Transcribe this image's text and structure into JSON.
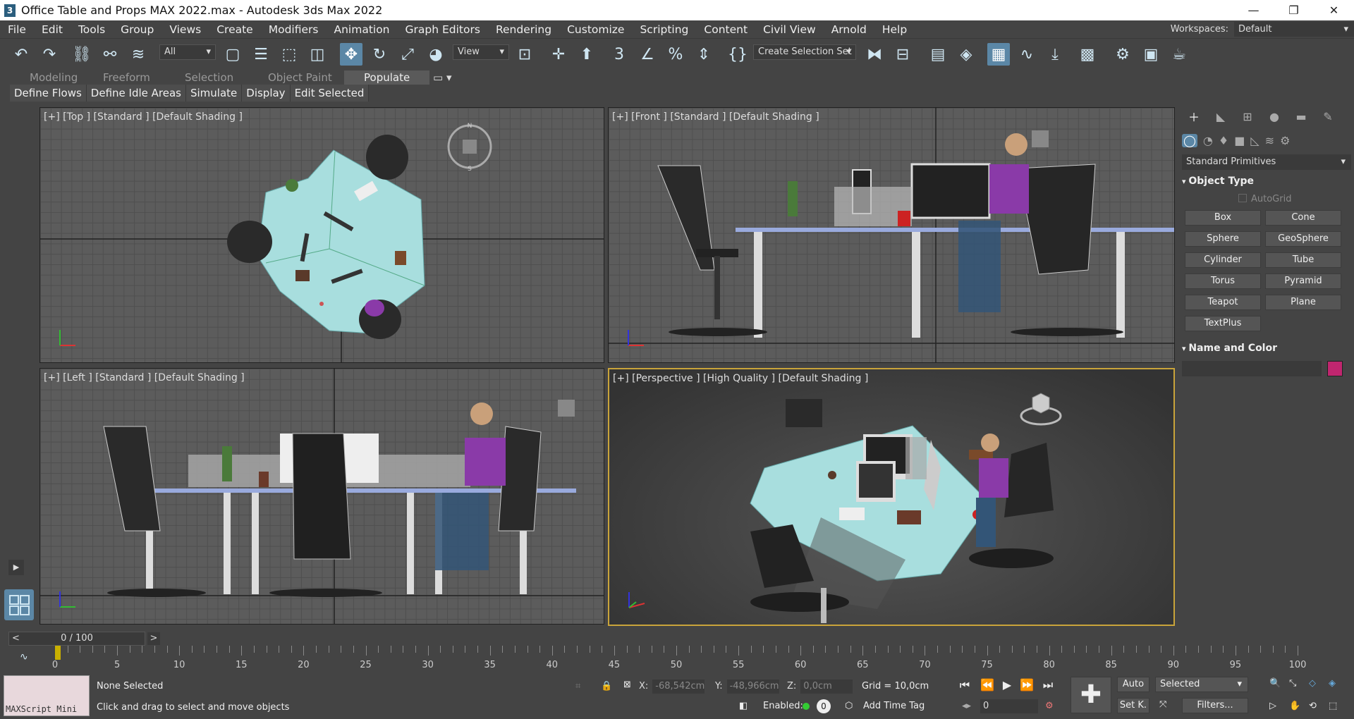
{
  "window": {
    "title": "Office Table and Props MAX 2022.max - Autodesk 3ds Max 2022",
    "app_icon": "3"
  },
  "menu": {
    "items": [
      "File",
      "Edit",
      "Tools",
      "Group",
      "Views",
      "Create",
      "Modifiers",
      "Animation",
      "Graph Editors",
      "Rendering",
      "Customize",
      "Scripting",
      "Content",
      "Civil View",
      "Arnold",
      "Help"
    ],
    "workspaces_label": "Workspaces:",
    "workspace_value": "Default"
  },
  "toolbar": {
    "filter": "All",
    "ref_coord": "View",
    "selection_set": "Create Selection Set"
  },
  "ribbon": {
    "tabs": [
      "Modeling",
      "Freeform",
      "Selection",
      "Object Paint",
      "Populate"
    ],
    "active": "Populate",
    "buttons": [
      "Define Flows",
      "Define Idle Areas",
      "Simulate",
      "Display",
      "Edit Selected"
    ]
  },
  "viewports": {
    "top": "[+] [Top ] [Standard ] [Default Shading ]",
    "front": "[+] [Front ] [Standard ] [Default Shading ]",
    "left": "[+] [Left ] [Standard ] [Default Shading ]",
    "perspective": "[+] [Perspective ] [High Quality ] [Default Shading ]"
  },
  "command_panel": {
    "category": "Standard Primitives",
    "object_type_title": "Object Type",
    "autogrid": "AutoGrid",
    "buttons": [
      "Box",
      "Cone",
      "Sphere",
      "GeoSphere",
      "Cylinder",
      "Tube",
      "Torus",
      "Pyramid",
      "Teapot",
      "Plane",
      "TextPlus"
    ],
    "name_color_title": "Name and Color",
    "swatch_color": "#c0266f"
  },
  "timeline": {
    "frame": "0 / 100",
    "ticks": [
      "0",
      "5",
      "10",
      "15",
      "20",
      "25",
      "30",
      "35",
      "40",
      "45",
      "50",
      "55",
      "60",
      "65",
      "70",
      "75",
      "80",
      "85",
      "90",
      "95",
      "100"
    ]
  },
  "status": {
    "maxscript": "MAXScript Mini",
    "selection": "None Selected",
    "prompt": "Click and drag to select and move objects",
    "x": "-68,542cm",
    "y": "-48,966cm",
    "z": "0,0cm",
    "grid": "Grid = 10,0cm",
    "enabled": "Enabled:",
    "enabled_count": "0",
    "time_tag": "Add Time Tag",
    "auto": "Auto",
    "selected": "Selected",
    "setk": "Set K.",
    "filters": "Filters...",
    "frame_field": "0"
  }
}
